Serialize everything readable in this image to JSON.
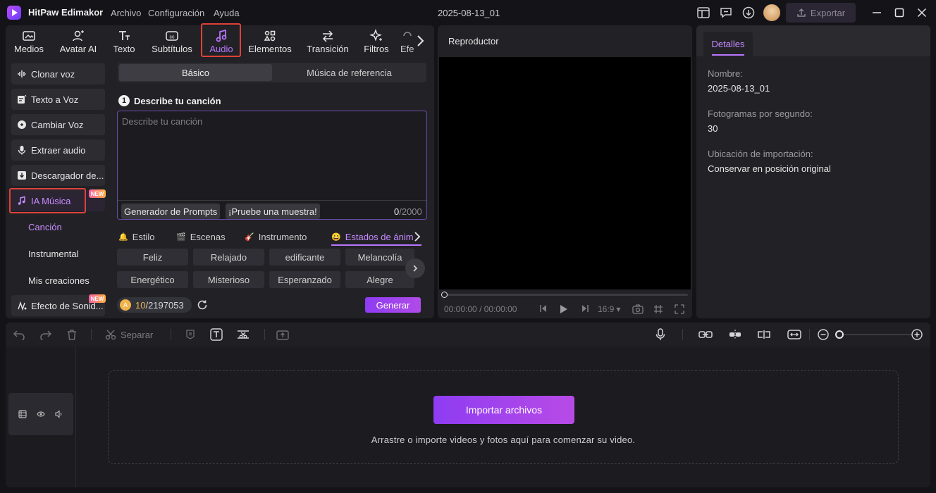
{
  "app": {
    "name": "HitPaw Edimakor",
    "project_title": "2025-08-13_01",
    "export_label": "Exportar"
  },
  "menu": [
    "Archivo",
    "Configuración",
    "Ayuda"
  ],
  "tabs": [
    {
      "label": "Medios",
      "icon": "media-icon"
    },
    {
      "label": "Avatar AI",
      "icon": "avatar-ai-icon"
    },
    {
      "label": "Texto",
      "icon": "text-icon"
    },
    {
      "label": "Subtítulos",
      "icon": "subtitles-icon"
    },
    {
      "label": "Audio",
      "icon": "audio-icon"
    },
    {
      "label": "Elementos",
      "icon": "elements-icon"
    },
    {
      "label": "Transición",
      "icon": "transition-icon"
    },
    {
      "label": "Filtros",
      "icon": "filters-icon"
    },
    {
      "label": "Efe",
      "icon": "effects-icon"
    }
  ],
  "sidebar": {
    "items": [
      {
        "label": "Clonar voz",
        "icon": "voice-wave-icon"
      },
      {
        "label": "Texto a Voz",
        "icon": "text-to-speech-icon"
      },
      {
        "label": "Cambiar Voz",
        "icon": "change-voice-icon"
      },
      {
        "label": "Extraer audio",
        "icon": "microphone-icon"
      },
      {
        "label": "Descargador de...",
        "icon": "download-icon"
      },
      {
        "label": "IA Música",
        "icon": "ai-music-icon",
        "badge": "NEW"
      },
      {
        "label": "Efecto de Sonid...",
        "icon": "sound-effect-icon",
        "badge": "NEW"
      }
    ],
    "sub_items": [
      "Canción",
      "Instrumental",
      "Mis creaciones"
    ]
  },
  "music": {
    "segments": [
      "Básico",
      "Música de referencia"
    ],
    "step_number": "1",
    "step_title": "Describe tu canción",
    "placeholder": "Describe tu canción",
    "prompt_button": "Generador de Prompts",
    "sample_button": "¡Pruebe una muestra!",
    "char_count": "0",
    "char_limit": "/2000",
    "categories": [
      "Estilo",
      "Escenas",
      "Instrumento",
      "Estados de ánim"
    ],
    "tags_row1": [
      "Feliz",
      "Relajado",
      "edificante",
      "Melancolía"
    ],
    "tags_row2": [
      "Energético",
      "Misterioso",
      "Esperanzado",
      "Alegre"
    ],
    "credits_used": "10",
    "credits_total": "/2197053",
    "generate_label": "Generar"
  },
  "player": {
    "title": "Reproductor",
    "time_current": "00:00:00",
    "time_total": "/ 00:00:00",
    "aspect": "16:9",
    "progress": 0
  },
  "details": {
    "tab": "Detalles",
    "fields": [
      {
        "label": "Nombre:",
        "value": "2025-08-13_01"
      },
      {
        "label": "Fotogramas por segundo:",
        "value": "30"
      },
      {
        "label": "Ubicación de importación:",
        "value": "Conservar en posición original"
      }
    ]
  },
  "timeline": {
    "split_label": "Separar",
    "import_label": "Importar archivos",
    "hint": "Arrastre o importe videos y fotos aquí para comenzar su video.",
    "zoom_level": 0
  },
  "colors": {
    "accent": "#b877ff",
    "button_gradient_start": "#8e3cf2",
    "button_gradient_end": "#b84be6",
    "highlight_box": "#e0413a",
    "new_badge": "#ff5fa2"
  }
}
